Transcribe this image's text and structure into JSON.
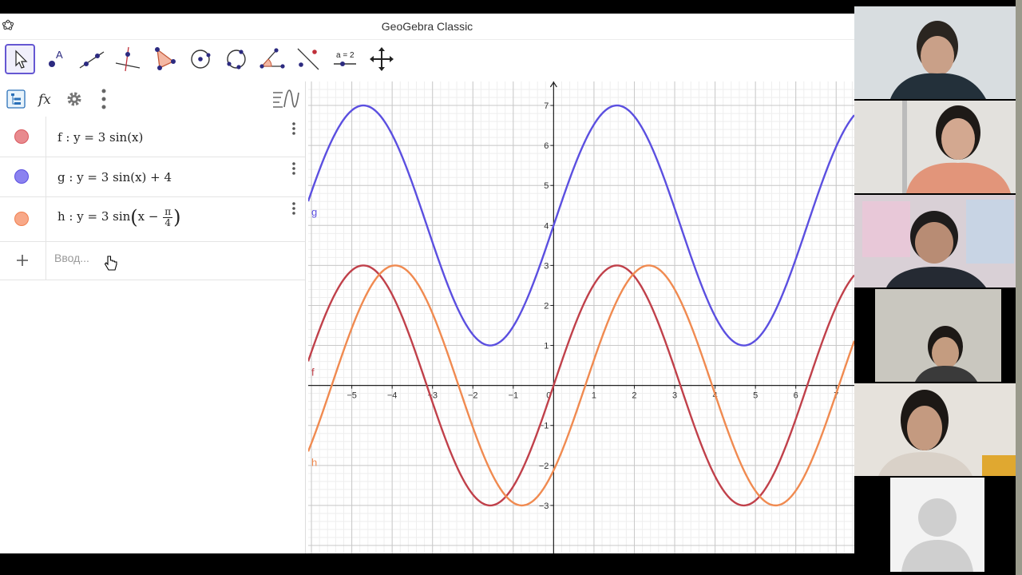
{
  "window": {
    "title": "GeoGebra Classic"
  },
  "toolbar": {
    "tools": [
      {
        "name": "move-tool-icon",
        "label": ""
      },
      {
        "name": "point-tool-icon",
        "label": "A"
      },
      {
        "name": "line-tool-icon",
        "label": ""
      },
      {
        "name": "perpendicular-line-tool-icon",
        "label": ""
      },
      {
        "name": "polygon-tool-icon",
        "label": ""
      },
      {
        "name": "circle-center-point-tool-icon",
        "label": ""
      },
      {
        "name": "circle-three-points-tool-icon",
        "label": ""
      },
      {
        "name": "angle-tool-icon",
        "label": ""
      },
      {
        "name": "reflect-tool-icon",
        "label": ""
      },
      {
        "name": "slider-tool-icon",
        "label": "a = 2"
      },
      {
        "name": "move-graphics-view-tool-icon",
        "label": ""
      }
    ]
  },
  "algebra": {
    "rows": [
      {
        "prefix": "f : y = 3 sin(x)",
        "color": "#d9595f",
        "dot_fill": "#e88a8e"
      },
      {
        "prefix": "g : y = 3 sin(x) + 4",
        "color": "#5b4fe0",
        "dot_fill": "#8b82f0"
      },
      {
        "prefix": "h : y = 3 sin",
        "arg_start": "x −",
        "frac_num": "π",
        "frac_den": "4",
        "color": "#f08050",
        "dot_fill": "#f8a888"
      }
    ],
    "input_placeholder": "Ввод..."
  },
  "chart_data": {
    "type": "line",
    "xlim": [
      -6.08,
      7.45
    ],
    "ylim": [
      -4.2,
      7.6
    ],
    "x_ticks": [
      "−5",
      "−4",
      "−3",
      "−2",
      "−1",
      "0",
      "1",
      "2",
      "3",
      "4",
      "5",
      "6",
      "7"
    ],
    "y_ticks": [
      "−3",
      "−2",
      "−1",
      "1",
      "2",
      "3",
      "4",
      "5",
      "6",
      "7"
    ],
    "grid": true,
    "series": [
      {
        "name": "f",
        "expr": "3 sin(x)",
        "amplitude": 3,
        "shift": 0,
        "offset": 0,
        "color": "#c0404a"
      },
      {
        "name": "g",
        "expr": "3 sin(x) + 4",
        "amplitude": 3,
        "shift": 0,
        "offset": 4,
        "color": "#5b4fe0"
      },
      {
        "name": "h",
        "expr": "3 sin(x − π/4)",
        "amplitude": 3,
        "shift": 0.7854,
        "offset": 0,
        "color": "#f08a50"
      }
    ]
  },
  "participants": {
    "count": 6
  }
}
